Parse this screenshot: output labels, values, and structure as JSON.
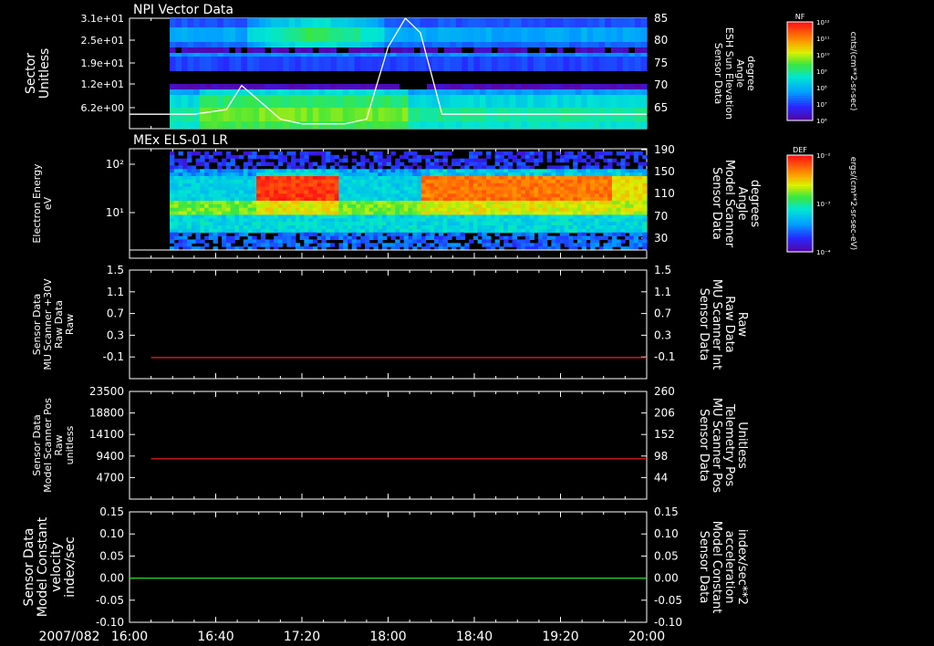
{
  "date_label": "2007/082",
  "time_ticks": [
    "16:00",
    "16:40",
    "17:20",
    "18:00",
    "18:40",
    "19:20",
    "20:00"
  ],
  "colors": {
    "white": "#ffffff",
    "red": "#ff2020",
    "green": "#20e020",
    "background": "#000000"
  },
  "panels": [
    {
      "id": "npi",
      "title": "NPI Vector Data",
      "left_label": [
        "Sector",
        "Unitless"
      ],
      "left_ticks": [
        "3.1e+01",
        "2.5e+01",
        "1.9e+01",
        "1.2e+01",
        "6.2e+00"
      ],
      "right_label": [
        "Sensor Data",
        "ESH Sun Elevation",
        "Angle",
        "degree"
      ],
      "right_ticks": [
        "85",
        "80",
        "75",
        "70",
        "65"
      ],
      "colorbar": {
        "label": "NF",
        "unit": "cnts/(cm**2-sr-sec)",
        "ticks": [
          "10¹²",
          "10¹¹",
          "10¹⁰",
          "10⁹",
          "10⁸",
          "10⁷",
          "10⁶"
        ]
      }
    },
    {
      "id": "els",
      "title": "MEx ELS-01 LR",
      "left_label": [
        "Electron Energy",
        "eV"
      ],
      "left_ticks": [
        "10²",
        "10¹"
      ],
      "right_label": [
        "Sensor Data",
        "Model Scanner",
        "Angle",
        "degrees"
      ],
      "right_ticks": [
        "190",
        "150",
        "110",
        "70",
        "30"
      ],
      "colorbar": {
        "label": "DEF",
        "unit": "ergs/(cm**2-sr-sec-eV)",
        "ticks": [
          "10⁻²",
          "10⁻³",
          "10⁻⁴"
        ]
      }
    },
    {
      "id": "mu30",
      "left_label": [
        "Sensor Data",
        "MU Scanner +30V",
        "Raw Data",
        "Raw"
      ],
      "left_ticks": [
        "1.5",
        "1.1",
        "0.7",
        "0.3",
        "-0.1"
      ],
      "right_label": [
        "Sensor Data",
        "MU Scanner Int",
        "Raw Data",
        "Raw"
      ],
      "right_ticks": [
        "1.5",
        "1.1",
        "0.7",
        "0.3",
        "-0.1"
      ]
    },
    {
      "id": "pos",
      "left_label": [
        "Sensor Data",
        "Model Scanner Pos",
        "Raw",
        "unitless"
      ],
      "left_ticks": [
        "23500",
        "18800",
        "14100",
        "9400",
        "4700"
      ],
      "right_label": [
        "Sensor Data",
        "MU Scanner Pos",
        "Telemetry Pos",
        "Unitless"
      ],
      "right_ticks": [
        "260",
        "206",
        "152",
        "98",
        "44"
      ]
    },
    {
      "id": "const",
      "left_label": [
        "Sensor Data",
        "Model Constant",
        "velocity",
        "index/sec"
      ],
      "left_ticks": [
        "0.15",
        "0.10",
        "0.05",
        "0.00",
        "-0.05",
        "-0.10"
      ],
      "right_label": [
        "Sensor Data",
        "Model Constant",
        "acceleration",
        "index/sec**2"
      ],
      "right_ticks": [
        "0.15",
        "0.10",
        "0.05",
        "0.00",
        "-0.05",
        "-0.10"
      ]
    }
  ],
  "chart_data": [
    {
      "type": "heatmap",
      "panel": "npi",
      "title": "NPI Vector Data",
      "ylim": [
        6.2,
        31
      ],
      "y2lim": [
        62,
        85
      ],
      "line_series": {
        "x": [
          "16:00",
          "16:30",
          "16:45",
          "16:52",
          "17:10",
          "17:20",
          "17:40",
          "17:50",
          "18:00",
          "18:08",
          "18:15",
          "18:25",
          "20:00"
        ],
        "y": [
          65,
          65,
          66,
          71,
          64,
          63,
          63,
          64,
          79,
          85,
          82,
          65,
          65
        ]
      }
    },
    {
      "type": "heatmap",
      "panel": "els",
      "title": "MEx ELS-01 LR",
      "ylabel": "Electron Energy eV",
      "yscale": "log",
      "line_series": {
        "x": [
          "16:00",
          "20:00"
        ],
        "y": [
          2,
          2
        ]
      }
    },
    {
      "type": "line",
      "panel": "mu30",
      "ylim": [
        -0.3,
        1.5
      ],
      "series": [
        {
          "x": [
            "16:10",
            "20:00"
          ],
          "y": [
            0.05,
            0.05
          ]
        }
      ]
    },
    {
      "type": "line",
      "panel": "pos",
      "ylim": [
        0,
        23500
      ],
      "series": [
        {
          "x": [
            "16:10",
            "20:00"
          ],
          "y": [
            8800,
            8800
          ]
        }
      ]
    },
    {
      "type": "line",
      "panel": "const",
      "ylim": [
        -0.1,
        0.15
      ],
      "series": [
        {
          "x": [
            "16:00",
            "20:00"
          ],
          "y": [
            0.0,
            0.0
          ]
        }
      ]
    }
  ]
}
